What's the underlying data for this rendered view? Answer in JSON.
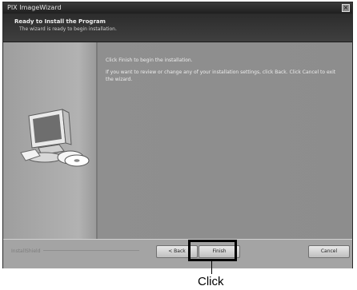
{
  "window": {
    "title": "PIX ImageWizard",
    "close_glyph": "×"
  },
  "header": {
    "title": "Ready to Install the Program",
    "subtitle": "The wizard is ready to begin installation."
  },
  "content": {
    "line1": "Click Finish to begin the installation.",
    "line2": "If you want to review or change any of your installation settings, click Back. Click Cancel to exit the wizard."
  },
  "footer": {
    "brand": "InstallShield",
    "buttons": {
      "back": "< Back",
      "finish": "Finish",
      "cancel": "Cancel"
    }
  },
  "annotation": {
    "label": "Click"
  },
  "colors": {
    "highlight": "#000000",
    "window_bg": "#a9a9a9",
    "header_bg": "#2c2c2c"
  },
  "icons": {
    "illustration": "computer-cd-icon"
  }
}
